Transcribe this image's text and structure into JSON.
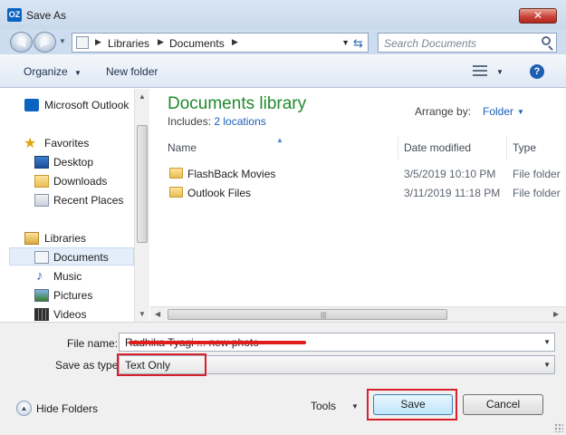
{
  "window": {
    "title": "Save As",
    "app_icon_text": "OZ",
    "close_glyph": "✕"
  },
  "address_bar": {
    "crumbs": [
      "Libraries",
      "Documents"
    ],
    "search_placeholder": "Search Documents"
  },
  "toolbar": {
    "organize_label": "Organize",
    "new_folder_label": "New folder",
    "help_glyph": "?"
  },
  "nav_pane": {
    "outlook": "Microsoft Outlook",
    "favorites": "Favorites",
    "desktop": "Desktop",
    "downloads": "Downloads",
    "recent_places": "Recent Places",
    "libraries": "Libraries",
    "documents": "Documents",
    "music": "Music",
    "pictures": "Pictures",
    "videos": "Videos",
    "selected": "Documents"
  },
  "library": {
    "title": "Documents library",
    "includes_label": "Includes:",
    "locations": "2 locations",
    "arrange_label": "Arrange by:",
    "arrange_value": "Folder"
  },
  "columns": {
    "name": "Name",
    "date_modified": "Date modified",
    "type": "Type"
  },
  "files": [
    {
      "name": "FlashBack Movies",
      "date": "3/5/2019 10:10 PM",
      "type": "File folder"
    },
    {
      "name": "Outlook Files",
      "date": "3/11/2019 11:18 PM",
      "type": "File folder"
    }
  ],
  "form": {
    "file_name_label": "File name:",
    "file_name_value": "Radhika Tyagi ... new photo",
    "save_as_type_label": "Save as type:",
    "save_as_type_value": "Text Only"
  },
  "footer": {
    "hide_folders_label": "Hide Folders",
    "tools_label": "Tools",
    "save_label": "Save",
    "cancel_label": "Cancel"
  },
  "colors": {
    "library_title": "#1e8a2c",
    "link": "#1c5eb5",
    "highlight": "#d8202c"
  }
}
